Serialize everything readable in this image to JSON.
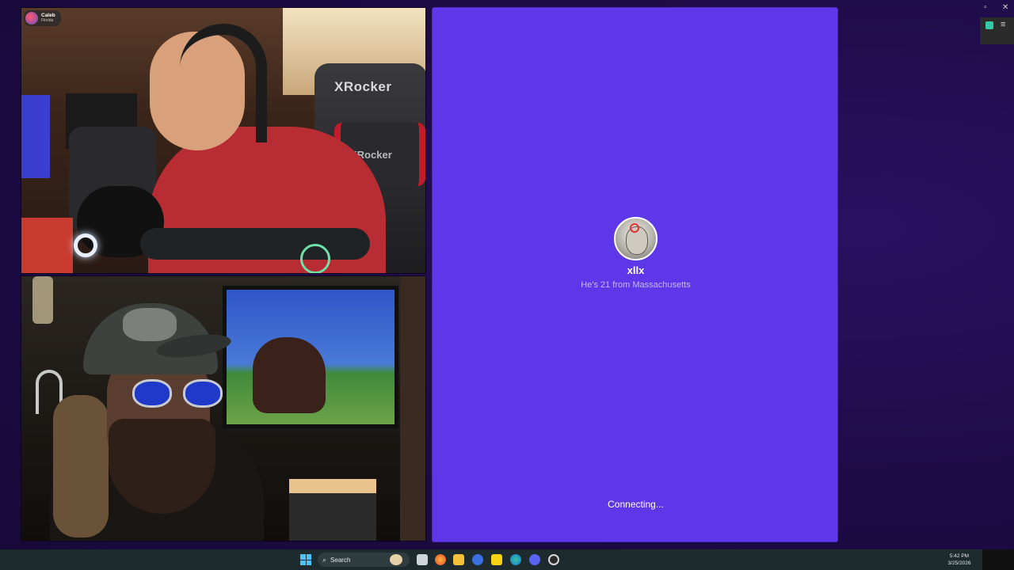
{
  "top_video": {
    "user_name": "Caleb",
    "user_location": "Florida",
    "chair_brand_top": "XRocker",
    "chair_brand_pad": "XRocker"
  },
  "match_card": {
    "name": "xllx",
    "subtitle": "He's 21 from Massachusetts",
    "status": "Connecting...",
    "background_color": "#5e38e8"
  },
  "window_controls": {
    "restore_glyph": "▫",
    "close_glyph": "✕",
    "menu_glyph": "≡"
  },
  "taskbar": {
    "search_placeholder": "Search",
    "search_icon": "⌕",
    "clock_time": "5:42 PM",
    "clock_date": "3/25/2026",
    "apps": [
      {
        "name": "start-icon"
      },
      {
        "name": "widgets-icon"
      },
      {
        "name": "task-view-icon"
      },
      {
        "name": "firefox-icon"
      },
      {
        "name": "file-explorer-icon"
      },
      {
        "name": "app-blue-icon"
      },
      {
        "name": "norton-icon"
      },
      {
        "name": "edge-icon"
      },
      {
        "name": "discord-icon"
      },
      {
        "name": "obs-icon"
      }
    ]
  }
}
